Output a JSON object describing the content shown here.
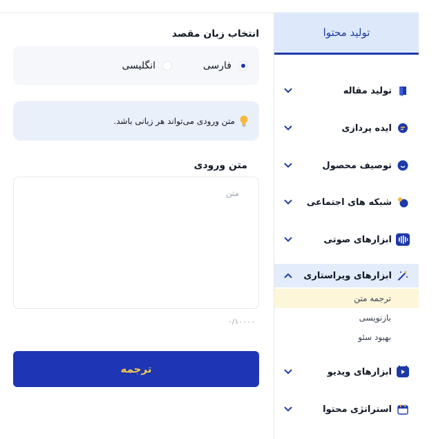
{
  "colors": {
    "primary": "#1e3aa8",
    "button_bg": "#1e36b3",
    "button_text": "#f5c94b",
    "sidebar_header_bg": "#dde9fb",
    "active_sub_bg": "#fef6d9",
    "tip_bg": "#e9f0fa"
  },
  "sidebar": {
    "header": "تولید محتوا",
    "items": [
      {
        "label": "تولید مقاله",
        "icon": "article-icon"
      },
      {
        "label": "ایده پردازی",
        "icon": "idea-icon"
      },
      {
        "label": "توصیف محصول",
        "icon": "product-icon"
      },
      {
        "label": "شبکه های اجتماعی",
        "icon": "social-icon"
      },
      {
        "label": "ابزارهای صوتی",
        "icon": "audio-icon"
      },
      {
        "label": "ابزارهای ویراستاری",
        "icon": "magic-wand-icon",
        "expanded": true
      },
      {
        "label": "ابزارهای ویدیو",
        "icon": "video-icon"
      },
      {
        "label": "استراتژی محتوا",
        "icon": "calendar-icon"
      }
    ],
    "editing_subitems": [
      "ترجمه متن",
      "بازنویسی",
      "بهبود سئو"
    ]
  },
  "main": {
    "target_language_title": "انتخاب زبان مقصد",
    "languages": [
      {
        "label": "فارسی",
        "selected": true
      },
      {
        "label": "انگلیسی",
        "selected": false
      }
    ],
    "tip_text": "متن ورودی می‌تواند هر زبانی باشد.",
    "input_label": "متن ورودی",
    "input_placeholder": "متن",
    "input_value": "",
    "counter": "۰/۱۰۰۰۰",
    "translate_button": "ترجمه"
  }
}
